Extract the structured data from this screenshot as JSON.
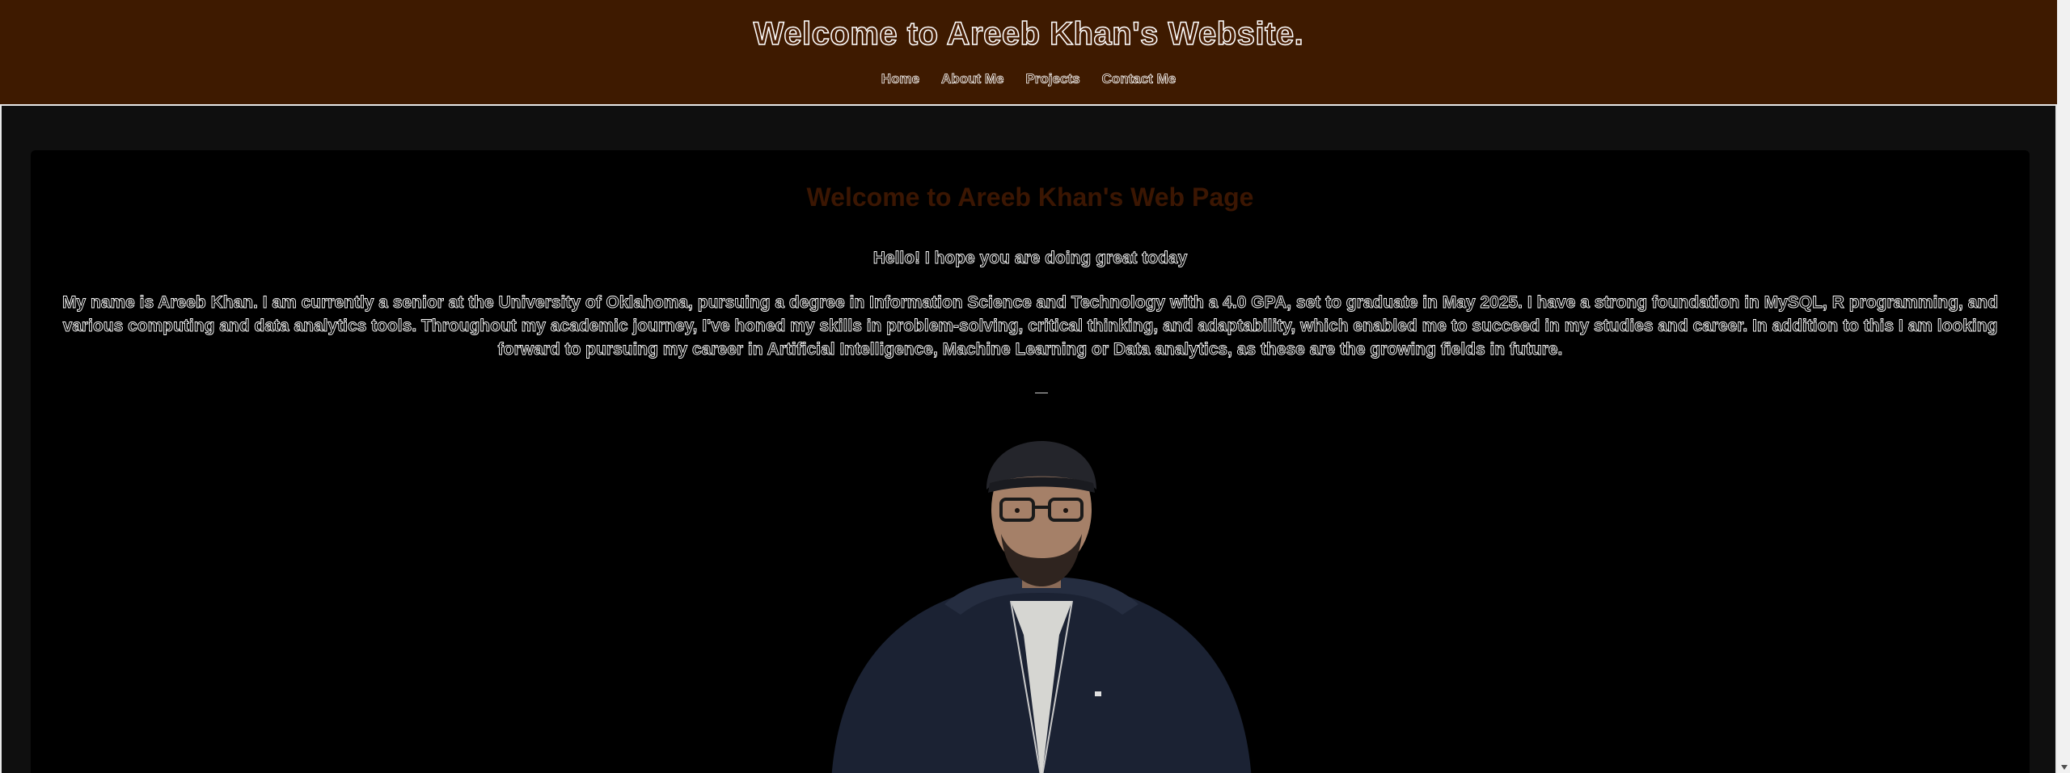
{
  "header": {
    "title": "Welcome to Areeb Khan's Website.",
    "nav": [
      {
        "label": "Home"
      },
      {
        "label": "About Me"
      },
      {
        "label": "Projects"
      },
      {
        "label": "Contact Me"
      }
    ]
  },
  "main": {
    "heading": "Welcome to Areeb Khan's Web Page",
    "greeting": "Hello! I hope you are doing great today",
    "bio": "My name is Areeb Khan. I am currently a senior at the University of Oklahoma, pursuing a degree in Information Science and Technology with a 4.0 GPA, set to graduate in May 2025. I have a strong foundation in MySQL, R programming, and various computing and data analytics tools. Throughout my academic journey, I've honed my skills in problem-solving, critical thinking, and adaptability, which enabled me to succeed in my studies and career. In addition to this I am looking forward to pursuing my career in Artificial Intelligence, Machine Learning or Data analytics, as these are the growing fields in future."
  },
  "colors": {
    "header_bg": "#3e1a00",
    "heading_text": "#3b1602",
    "card_bg": "#000000",
    "page_bg": "#111111"
  }
}
